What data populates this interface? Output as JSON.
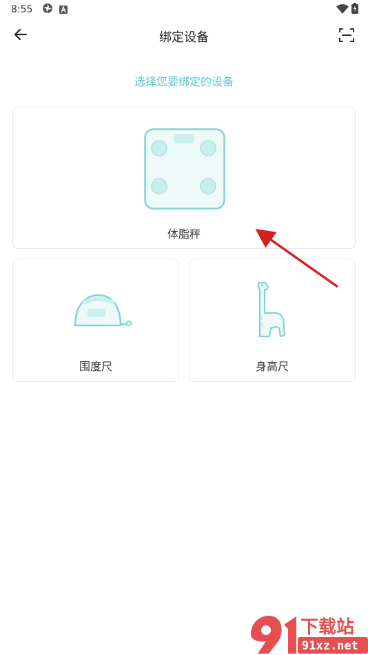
{
  "status_bar": {
    "time": "8:55",
    "left_icons": [
      "pinwheel-icon",
      "text-a-icon"
    ],
    "right_icons": [
      "wifi-icon",
      "battery-icon"
    ]
  },
  "header": {
    "title": "绑定设备",
    "back_icon": "arrow-left-icon",
    "scan_icon": "scan-frame-icon"
  },
  "subtitle": "选择您要绑定的设备",
  "devices": [
    {
      "label": "体脂秤",
      "icon": "body-fat-scale-icon"
    },
    {
      "label": "围度尺",
      "icon": "tape-measure-icon"
    },
    {
      "label": "身高尺",
      "icon": "giraffe-height-ruler-icon"
    }
  ],
  "colors": {
    "accent": "#5ec4c8",
    "icon_stroke": "#7fd3d6",
    "icon_fill": "#eef9f9",
    "card_border": "#e4e4e4",
    "annotation_arrow": "#d42020"
  },
  "watermark": {
    "logo_text": "下载站",
    "site": "91xz.net"
  }
}
